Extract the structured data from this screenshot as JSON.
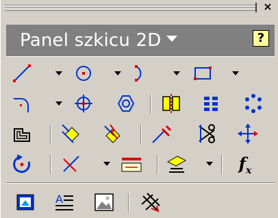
{
  "panel": {
    "title": "Panel szkicu 2D",
    "help_label": "?",
    "close_label": "×",
    "fx_label": "f",
    "fx_sub": "x"
  },
  "tools": {
    "row1": [
      "line",
      "circle",
      "arc",
      "rectangle"
    ],
    "row2": [
      "fillet",
      "point",
      "polygon",
      "mirror",
      "rectangular-pattern",
      "circular-pattern"
    ],
    "row3": [
      "offset",
      "extend",
      "trim",
      "split",
      "scissors",
      "move"
    ],
    "row4": [
      "rotate",
      "general-dimension",
      "dimension-edit",
      "project-geometry",
      "parameters"
    ],
    "row5": [
      "insert-image",
      "text",
      "picture",
      "hatch"
    ]
  },
  "colors": {
    "background": "#d4d0c8",
    "header": "#808080",
    "accent_blue": "#0033cc",
    "accent_red": "#e00000",
    "accent_yellow": "#ffff00"
  }
}
